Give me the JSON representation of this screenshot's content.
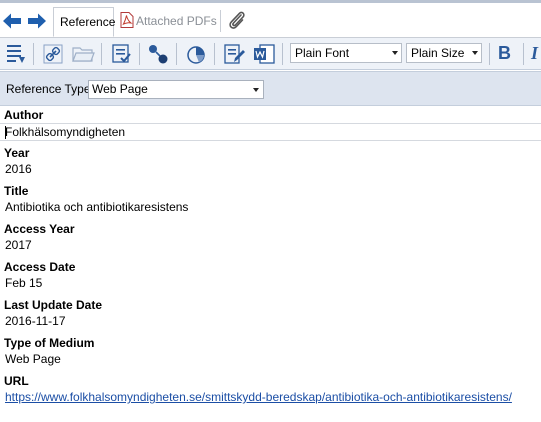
{
  "tabs": [
    {
      "label": "Reference",
      "active": true
    },
    {
      "label": "Attached PDFs",
      "active": false
    }
  ],
  "toolbar": {
    "font_select": "Plain Font",
    "size_select": "Plain Size",
    "bold_label": "B",
    "italic_label": "I"
  },
  "reference_type": {
    "label": "Reference Type:",
    "value": "Web Page"
  },
  "fields": [
    {
      "label": "Author",
      "value": "Folkhälsomyndigheten"
    },
    {
      "label": "Year",
      "value": "2016"
    },
    {
      "label": "Title",
      "value": "Antibiotika och antibiotikaresistens"
    },
    {
      "label": "Access Year",
      "value": "2017"
    },
    {
      "label": "Access Date",
      "value": "Feb 15"
    },
    {
      "label": "Last Update Date",
      "value": "2016-11-17"
    },
    {
      "label": "Type of Medium",
      "value": "Web Page"
    },
    {
      "label": "URL",
      "value": "https://www.folkhalsomyndigheten.se/smittskydd-beredskap/antibiotika-och-antibiotikaresistens/"
    }
  ],
  "colors": {
    "toolbar_bg": "#eef2f8",
    "reftype_bg": "#dde4ef",
    "icon_blue": "#2b5a9b",
    "link_blue": "#1b4ea5"
  },
  "icons": {
    "back": "arrow-left-icon",
    "forward": "arrow-right-icon",
    "pdf": "pdf-icon",
    "attach": "paperclip-icon"
  }
}
